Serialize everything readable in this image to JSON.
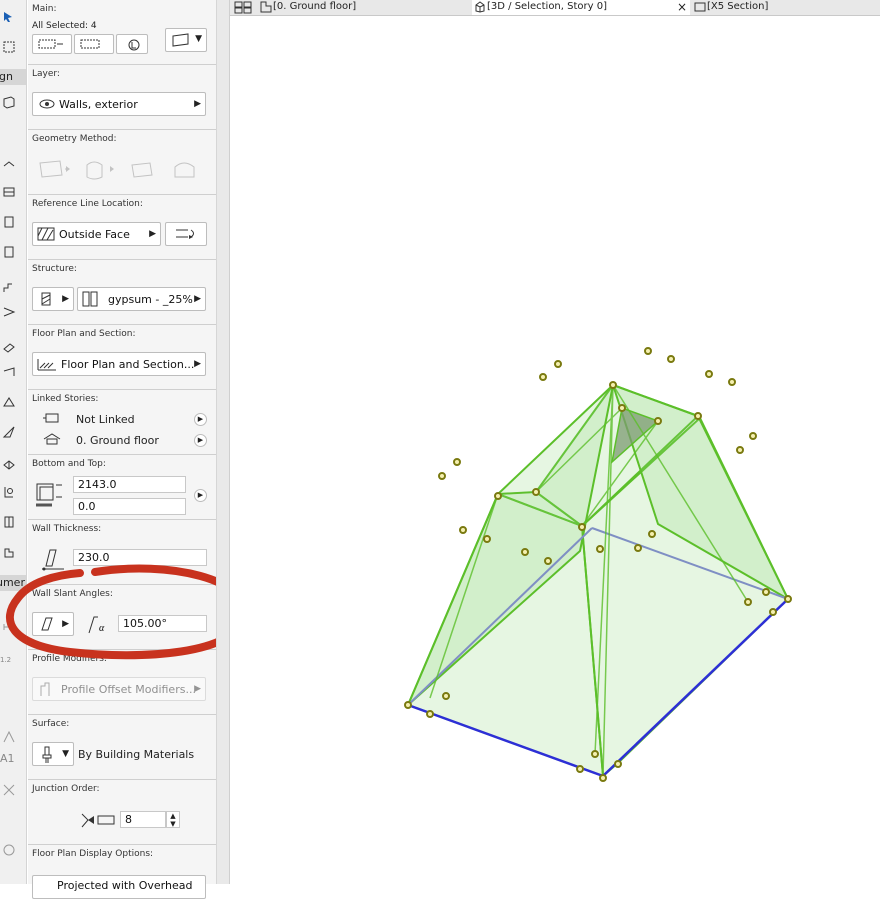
{
  "toolbox": {
    "design_label": "ign",
    "document_label": "umer",
    "dim_glyph_a": "A1",
    "dim_glyph_b": "1.2"
  },
  "main": {
    "title": "Main:",
    "selection": "All Selected: 4"
  },
  "layer": {
    "title": "Layer:",
    "value": "Walls, exterior"
  },
  "geometry": {
    "title": "Geometry Method:"
  },
  "reference_line": {
    "title": "Reference Line Location:",
    "value": "Outside Face"
  },
  "structure": {
    "title": "Structure:",
    "value": "gypsum - _25%"
  },
  "floor_plan": {
    "title": "Floor Plan and Section:",
    "value": "Floor Plan and Section..."
  },
  "linked_stories": {
    "title": "Linked Stories:",
    "top": "Not Linked",
    "bottom": "0. Ground floor"
  },
  "bottom_top": {
    "title": "Bottom and Top:",
    "height": "2143.0",
    "offset": "0.0"
  },
  "wall_thickness": {
    "title": "Wall Thickness:",
    "value": "230.0"
  },
  "slant": {
    "title": "Wall Slant Angles:",
    "value": "105.00°"
  },
  "profile_modifiers": {
    "title": "Profile Modifiers:",
    "value": "Profile Offset Modifiers..."
  },
  "surface": {
    "title": "Surface:",
    "value": "By Building Materials"
  },
  "junction": {
    "title": "Junction Order:",
    "value": "8"
  },
  "display_options": {
    "title": "Floor Plan Display Options:",
    "value": "Projected with Overhead"
  },
  "tabs": [
    {
      "label": "[0. Ground floor]"
    },
    {
      "label": "[3D / Selection, Story 0]",
      "close": "×"
    },
    {
      "label": "[X5 Section]"
    }
  ],
  "colors": {
    "wall_fill": "#8fd67a",
    "wall_edge": "#5cbf2a",
    "base_line": "#2d2fd6",
    "hidden_line": "#7f8fc4",
    "hotspot": "#7a7a10",
    "annotation_circle": "#c8321e"
  }
}
